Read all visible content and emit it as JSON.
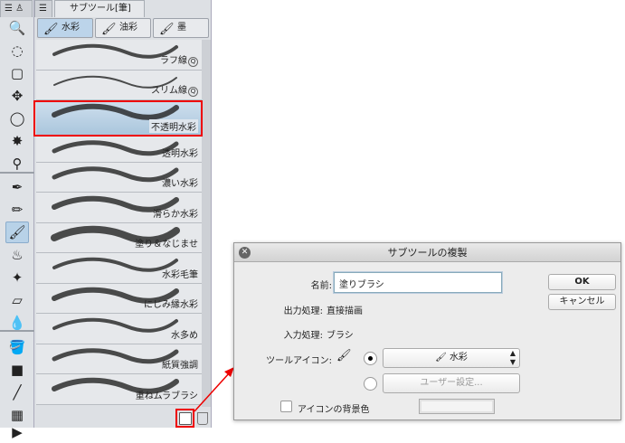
{
  "toolbar": {
    "tools": [
      "zoom-icon",
      "rotate-icon",
      "object-icon",
      "move-icon",
      "lasso-icon",
      "auto-select-icon",
      "eyedropper-icon",
      "pen-icon",
      "pencil-icon",
      "brush-icon",
      "airbrush-icon",
      "decoration-icon",
      "eraser-icon",
      "blend-icon",
      "fill-icon",
      "gradient-icon",
      "line-icon",
      "frame-icon",
      "operation-icon"
    ],
    "glyphs": [
      "🔍",
      "◌",
      "▢",
      "✥",
      "◯",
      "✸",
      "⚲",
      "✒",
      "✏",
      "🖌",
      "♨",
      "✦",
      "▱",
      "💧",
      "🪣",
      "■",
      "╱",
      "▦",
      "▶"
    ]
  },
  "panel": {
    "tab_label": "サブツール[筆]",
    "categories": [
      {
        "label": "水彩",
        "icon": "🖌"
      },
      {
        "label": "油彩",
        "icon": "🖌"
      },
      {
        "label": "墨",
        "icon": "🖌"
      }
    ],
    "items": [
      {
        "label": "ラフ線"
      },
      {
        "label": "スリム線"
      },
      {
        "label": "不透明水彩"
      },
      {
        "label": "透明水彩"
      },
      {
        "label": "濃い水彩"
      },
      {
        "label": "滑らか水彩"
      },
      {
        "label": "塗り＆なじませ"
      },
      {
        "label": "水彩毛筆"
      },
      {
        "label": "にじみ縁水彩"
      },
      {
        "label": "水多め"
      },
      {
        "label": "紙質強調"
      },
      {
        "label": "重ねムラブラシ"
      }
    ],
    "zoom_badge": "Q"
  },
  "dialog": {
    "title": "サブツールの複製",
    "name_label": "名前:",
    "name_value": "塗りブラシ",
    "output_label": "出力処理:",
    "output_value": "直接描画",
    "input_label": "入力処理:",
    "input_value": "ブラシ",
    "icon_label": "ツールアイコン:",
    "icon_select": "水彩",
    "user_setting": "ユーザー設定...",
    "bg_label": "アイコンの背景色",
    "ok": "OK",
    "cancel": "キャンセル"
  },
  "colors": {
    "highlight": "#e00000",
    "selected": "#bcd4ea"
  }
}
